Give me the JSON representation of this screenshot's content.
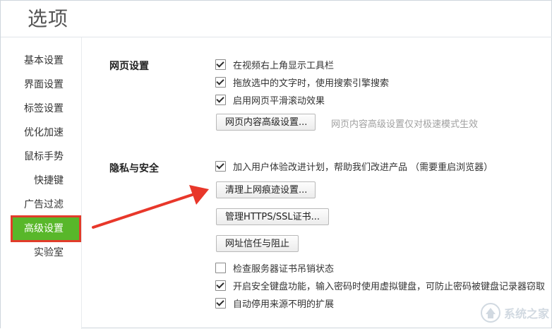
{
  "window": {
    "title": "选项"
  },
  "sidebar": {
    "items": [
      {
        "label": "基本设置"
      },
      {
        "label": "界面设置"
      },
      {
        "label": "标签设置"
      },
      {
        "label": "优化加速"
      },
      {
        "label": "鼠标手势"
      },
      {
        "label": "快捷键"
      },
      {
        "label": "广告过滤"
      },
      {
        "label": "高级设置",
        "active": true
      },
      {
        "label": "实验室"
      }
    ]
  },
  "web_settings": {
    "label": "网页设置",
    "options": [
      {
        "label": "在视频右上角显示工具栏",
        "checked": true
      },
      {
        "label": "拖放选中的文字时，使用搜索引擎搜索",
        "checked": true
      },
      {
        "label": "启用网页平滑滚动效果",
        "checked": true
      }
    ],
    "advanced_button": "网页内容高级设置...",
    "advanced_hint": "网页内容高级设置仅对极速模式生效"
  },
  "privacy": {
    "label": "隐私与安全",
    "ux_plan": {
      "label": "加入用户体验改进计划，帮助我们改进产品 （需要重启浏览器）",
      "checked": true
    },
    "clear_button": "清理上网痕迹设置...",
    "cert_button": "管理HTTPS/SSL证书...",
    "trust_button": "网址信任与阻止",
    "options": [
      {
        "label": "检查服务器证书吊销状态",
        "checked": false
      },
      {
        "label": "开启安全键盘功能，输入密码时使用虚拟键盘，可防止密码被键盘记录器窃取",
        "checked": true
      },
      {
        "label": "自动停用来源不明的扩展",
        "checked": true
      }
    ]
  },
  "annotation": {
    "arrow_color": "#e8372a",
    "highlight_color": "#e13c2a"
  },
  "colors": {
    "active_item_bg": "#58b72a"
  },
  "watermark": {
    "text": "系统之家"
  }
}
